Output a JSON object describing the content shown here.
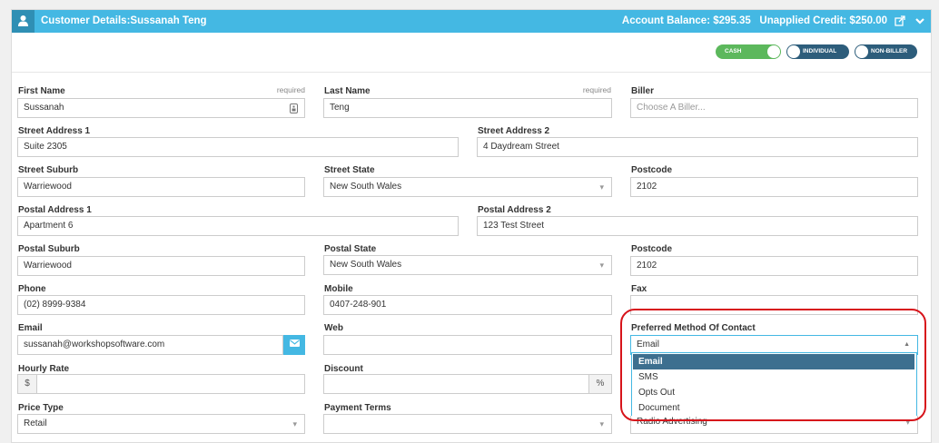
{
  "header": {
    "title": "Customer Details:",
    "customer_name": "Sussanah Teng",
    "balance": "Account Balance: $295.35",
    "unapplied": "Unapplied Credit: $250.00"
  },
  "toggles": {
    "cash": "CASH",
    "individual": "INDIVIDUAL",
    "non_biller": "NON-BILLER"
  },
  "form": {
    "required_text": "required",
    "first_name": {
      "label": "First Name",
      "value": "Sussanah"
    },
    "last_name": {
      "label": "Last Name",
      "value": "Teng"
    },
    "biller": {
      "label": "Biller",
      "placeholder": "Choose A Biller..."
    },
    "street_address_1": {
      "label": "Street Address 1",
      "value": "Suite 2305"
    },
    "street_address_2": {
      "label": "Street Address 2",
      "value": "4 Daydream Street"
    },
    "street_suburb": {
      "label": "Street Suburb",
      "value": "Warriewood"
    },
    "street_state": {
      "label": "Street State",
      "value": "New South Wales"
    },
    "street_postcode": {
      "label": "Postcode",
      "value": "2102"
    },
    "postal_address_1": {
      "label": "Postal Address 1",
      "value": "Apartment 6"
    },
    "postal_address_2": {
      "label": "Postal Address 2",
      "value": "123 Test Street"
    },
    "postal_suburb": {
      "label": "Postal Suburb",
      "value": "Warriewood"
    },
    "postal_state": {
      "label": "Postal State",
      "value": "New South Wales"
    },
    "postal_postcode": {
      "label": "Postcode",
      "value": "2102"
    },
    "phone": {
      "label": "Phone",
      "value": "(02) 8999-9384"
    },
    "mobile": {
      "label": "Mobile",
      "value": "0407-248-901"
    },
    "fax": {
      "label": "Fax",
      "value": ""
    },
    "email": {
      "label": "Email",
      "value": "sussanah@workshopsoftware.com"
    },
    "web": {
      "label": "Web",
      "value": ""
    },
    "preferred_contact": {
      "label": "Preferred Method Of Contact",
      "value": "Email",
      "options": [
        "Email",
        "SMS",
        "Opts Out",
        "Document"
      ]
    },
    "hourly_rate": {
      "label": "Hourly Rate",
      "prefix": "$",
      "value": ""
    },
    "discount": {
      "label": "Discount",
      "suffix": "%",
      "value": ""
    },
    "price_type": {
      "label": "Price Type",
      "value": "Retail"
    },
    "payment_terms": {
      "label": "Payment Terms",
      "value": ""
    },
    "referral_source": {
      "value": "Radio Advertising"
    }
  },
  "colors": {
    "header": "#44b8e3",
    "toggle_on": "#5cb85c",
    "toggle_dark": "#2d5d7b",
    "highlight": "#d7141b",
    "selected_option": "#3d6f8f"
  }
}
